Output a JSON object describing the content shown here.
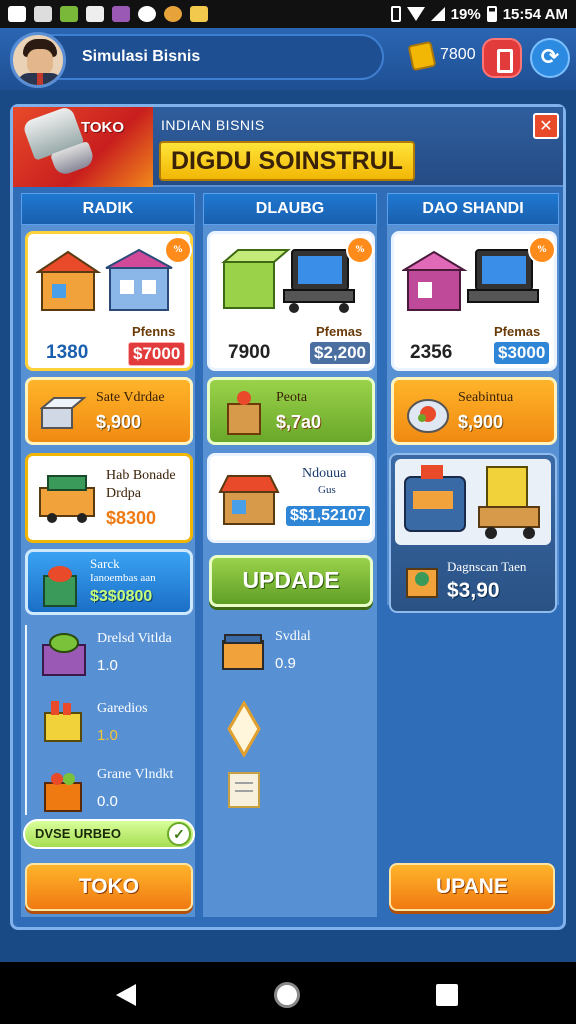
{
  "status_bar": {
    "battery": "19%",
    "time": "15:54 AM"
  },
  "header": {
    "player_name": "Simulasi Bisnis",
    "coins": "7800",
    "red_button_icon": "door-icon",
    "blue_button_icon": "refresh-icon"
  },
  "banner": {
    "tag": "TOKO",
    "subtitle": "INDIAN BISNIS",
    "title": "DIGDU SOINSTRUL"
  },
  "columns": [
    {
      "header": "RADIK"
    },
    {
      "header": "DLAUBG"
    },
    {
      "header": "DAO SHANDI"
    }
  ],
  "store_cards": [
    {
      "label": "Pfenns",
      "amount": "1380",
      "price": "$7000",
      "badge": "%"
    },
    {
      "label": "Pfemas",
      "amount": "7900",
      "price": "$2,200",
      "badge": "%"
    },
    {
      "label": "Pfemas",
      "amount": "2356",
      "price": "$3000",
      "badge": "%"
    }
  ],
  "offer_buttons": [
    {
      "name": "Sate Vdrdae",
      "price": "$,900",
      "style": "orange"
    },
    {
      "name": "Peota",
      "price": "$,7a0",
      "style": "green"
    },
    {
      "name": "Seabintua",
      "price": "$,900",
      "style": "orange"
    }
  ],
  "col1": {
    "mid_card": {
      "title": "Hab Bonade",
      "sub": "Drdpa",
      "price": "$8300"
    },
    "blue_card": {
      "title": "Sarck",
      "sub": "Ianoembas aan",
      "price": "$3$0800"
    },
    "list": [
      {
        "name": "Drelsd Vitlda",
        "value": "1.0"
      },
      {
        "name": "Garedios",
        "value": "1.0"
      },
      {
        "name": "Grane Vlndkt",
        "value": "0.0"
      }
    ],
    "progress_label": "DVSE URBEO",
    "button": "TOKO"
  },
  "col2": {
    "mid_card": {
      "title": "Ndouua",
      "sub": "Gus",
      "price": "$$1,52107"
    },
    "upgrade_button": "UPDADE",
    "list": [
      {
        "name": "Svdlal",
        "value": "0.9"
      }
    ]
  },
  "col3": {
    "mid_card": {
      "title": "Dagnscan Taen",
      "price": "$3,90"
    },
    "button": "UPANE"
  },
  "colors": {
    "accent": "#f2b705",
    "panel": "#2f6db8",
    "danger": "#e23b3b",
    "success": "#6aa82a"
  }
}
